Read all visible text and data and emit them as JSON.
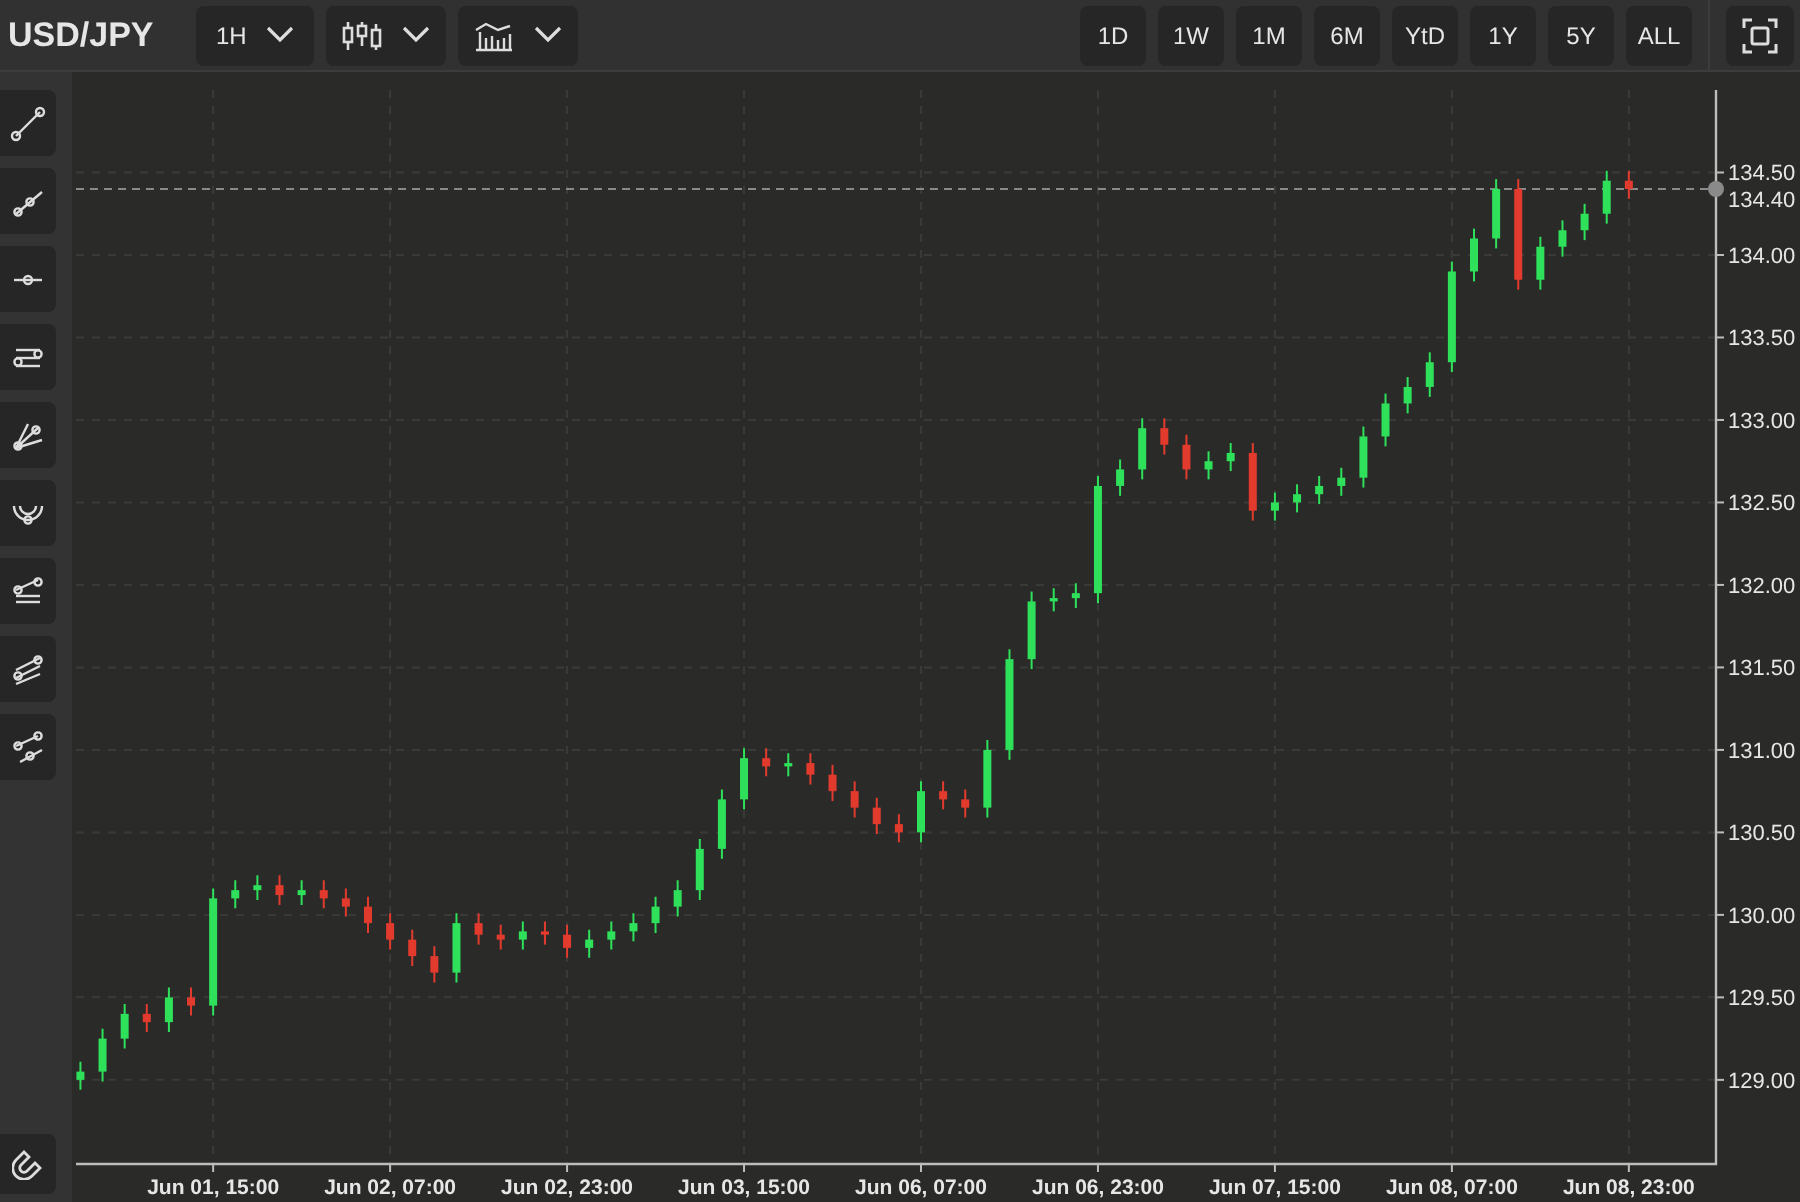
{
  "header": {
    "symbol": "USD/JPY",
    "interval": "1H"
  },
  "ranges": [
    {
      "label": "1D",
      "selected": false
    },
    {
      "label": "1W",
      "selected": false
    },
    {
      "label": "1M",
      "selected": false
    },
    {
      "label": "6M",
      "selected": false
    },
    {
      "label": "YtD",
      "selected": false
    },
    {
      "label": "1Y",
      "selected": false
    },
    {
      "label": "5Y",
      "selected": false
    },
    {
      "label": "ALL",
      "selected": false
    }
  ],
  "chart": {
    "chart_data": {
      "type": "candlestick",
      "grid": true,
      "ylim": [
        128.49,
        135.0
      ],
      "yticks": [
        {
          "value": 129.0,
          "label": "129.00"
        },
        {
          "value": 129.5,
          "label": "129.50"
        },
        {
          "value": 130.0,
          "label": "130.00"
        },
        {
          "value": 130.5,
          "label": "130.50"
        },
        {
          "value": 131.0,
          "label": "131.00"
        },
        {
          "value": 131.5,
          "label": "131.50"
        },
        {
          "value": 132.0,
          "label": "132.00"
        },
        {
          "value": 132.5,
          "label": "132.50"
        },
        {
          "value": 133.0,
          "label": "133.00"
        },
        {
          "value": 133.5,
          "label": "133.50"
        },
        {
          "value": 134.0,
          "label": "134.00"
        },
        {
          "value": 134.5,
          "label": "134.50"
        }
      ],
      "categories": [
        null,
        null,
        null,
        null,
        null,
        null,
        "Jun 01, 15:00",
        null,
        null,
        null,
        null,
        null,
        null,
        null,
        "Jun 02, 07:00",
        null,
        null,
        null,
        null,
        null,
        null,
        null,
        "Jun 02, 23:00",
        null,
        null,
        null,
        null,
        null,
        null,
        null,
        "Jun 03, 15:00",
        null,
        null,
        null,
        null,
        null,
        null,
        null,
        "Jun 06, 07:00",
        null,
        null,
        null,
        null,
        null,
        null,
        null,
        "Jun 06, 23:00",
        null,
        null,
        null,
        null,
        null,
        null,
        null,
        "Jun 07, 15:00",
        null,
        null,
        null,
        null,
        null,
        null,
        null,
        "Jun 08, 07:00",
        null,
        null,
        null,
        null,
        null,
        null,
        null,
        "Jun 08, 23:00"
      ],
      "ref_lines": [
        {
          "axis": "y",
          "value": 134.4,
          "label": "134.40"
        }
      ],
      "ohlc": [
        [
          129.0,
          129.11,
          128.94,
          129.05
        ],
        [
          129.05,
          129.31,
          128.99,
          129.25
        ],
        [
          129.25,
          129.46,
          129.19,
          129.4
        ],
        [
          129.4,
          129.46,
          129.29,
          129.35
        ],
        [
          129.35,
          129.56,
          129.29,
          129.5
        ],
        [
          129.5,
          129.56,
          129.39,
          129.45
        ],
        [
          129.45,
          130.16,
          129.39,
          130.1
        ],
        [
          130.1,
          130.21,
          130.04,
          130.15
        ],
        [
          130.15,
          130.24,
          130.09,
          130.18
        ],
        [
          130.18,
          130.24,
          130.06,
          130.12
        ],
        [
          130.12,
          130.21,
          130.06,
          130.15
        ],
        [
          130.15,
          130.21,
          130.04,
          130.1
        ],
        [
          130.1,
          130.16,
          129.99,
          130.05
        ],
        [
          130.05,
          130.11,
          129.89,
          129.95
        ],
        [
          129.95,
          130.01,
          129.79,
          129.85
        ],
        [
          129.85,
          129.91,
          129.69,
          129.75
        ],
        [
          129.75,
          129.81,
          129.59,
          129.65
        ],
        [
          129.65,
          130.01,
          129.59,
          129.95
        ],
        [
          129.95,
          130.01,
          129.82,
          129.88
        ],
        [
          129.88,
          129.94,
          129.79,
          129.85
        ],
        [
          129.85,
          129.96,
          129.79,
          129.9
        ],
        [
          129.9,
          129.96,
          129.82,
          129.88
        ],
        [
          129.88,
          129.94,
          129.74,
          129.8
        ],
        [
          129.8,
          129.91,
          129.74,
          129.85
        ],
        [
          129.85,
          129.96,
          129.79,
          129.9
        ],
        [
          129.9,
          130.01,
          129.84,
          129.95
        ],
        [
          129.95,
          130.11,
          129.89,
          130.05
        ],
        [
          130.05,
          130.21,
          129.99,
          130.15
        ],
        [
          130.15,
          130.46,
          130.09,
          130.4
        ],
        [
          130.4,
          130.76,
          130.34,
          130.7
        ],
        [
          130.7,
          131.01,
          130.64,
          130.95
        ],
        [
          130.95,
          131.01,
          130.84,
          130.9
        ],
        [
          130.9,
          130.98,
          130.84,
          130.92
        ],
        [
          130.92,
          130.98,
          130.79,
          130.85
        ],
        [
          130.85,
          130.91,
          130.69,
          130.75
        ],
        [
          130.75,
          130.81,
          130.59,
          130.65
        ],
        [
          130.65,
          130.71,
          130.49,
          130.55
        ],
        [
          130.55,
          130.61,
          130.44,
          130.5
        ],
        [
          130.5,
          130.81,
          130.44,
          130.75
        ],
        [
          130.75,
          130.81,
          130.64,
          130.7
        ],
        [
          130.7,
          130.76,
          130.59,
          130.65
        ],
        [
          130.65,
          131.06,
          130.59,
          131.0
        ],
        [
          131.0,
          131.61,
          130.94,
          131.55
        ],
        [
          131.55,
          131.96,
          131.49,
          131.9
        ],
        [
          131.9,
          131.98,
          131.84,
          131.92
        ],
        [
          131.92,
          132.01,
          131.86,
          131.95
        ],
        [
          131.95,
          132.66,
          131.89,
          132.6
        ],
        [
          132.6,
          132.76,
          132.54,
          132.7
        ],
        [
          132.7,
          133.01,
          132.64,
          132.95
        ],
        [
          132.95,
          133.01,
          132.79,
          132.85
        ],
        [
          132.85,
          132.91,
          132.64,
          132.7
        ],
        [
          132.7,
          132.81,
          132.64,
          132.75
        ],
        [
          132.75,
          132.86,
          132.69,
          132.8
        ],
        [
          132.8,
          132.86,
          132.39,
          132.45
        ],
        [
          132.45,
          132.56,
          132.39,
          132.5
        ],
        [
          132.5,
          132.61,
          132.44,
          132.55
        ],
        [
          132.55,
          132.66,
          132.49,
          132.6
        ],
        [
          132.6,
          132.71,
          132.54,
          132.65
        ],
        [
          132.65,
          132.96,
          132.59,
          132.9
        ],
        [
          132.9,
          133.16,
          132.84,
          133.1
        ],
        [
          133.1,
          133.26,
          133.04,
          133.2
        ],
        [
          133.2,
          133.41,
          133.14,
          133.35
        ],
        [
          133.35,
          133.96,
          133.29,
          133.9
        ],
        [
          133.9,
          134.16,
          133.84,
          134.1
        ],
        [
          134.1,
          134.46,
          134.04,
          134.4
        ],
        [
          134.4,
          134.46,
          133.79,
          133.85
        ],
        [
          133.85,
          134.11,
          133.79,
          134.05
        ],
        [
          134.05,
          134.21,
          133.99,
          134.15
        ],
        [
          134.15,
          134.31,
          134.09,
          134.25
        ],
        [
          134.25,
          134.51,
          134.19,
          134.45
        ],
        [
          134.45,
          134.51,
          134.34,
          134.4
        ]
      ]
    }
  }
}
